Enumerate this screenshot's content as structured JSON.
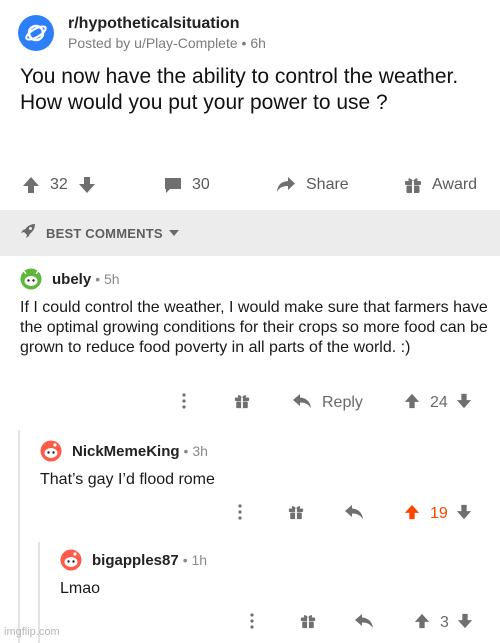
{
  "post": {
    "subreddit": "r/hypotheticalsituation",
    "posted_by": "Posted by u/Play-Complete • 6h",
    "title": "You now have the ability to control the weather. How would you put your power to use ?",
    "score": "32",
    "comment_count": "30",
    "share_label": "Share",
    "award_label": "Award"
  },
  "sort": {
    "label": "BEST COMMENTS"
  },
  "comments": [
    {
      "user": "ubely",
      "age": "• 5h",
      "body": "If I could control the weather, I would make sure that farmers have the optimal growing conditions for their crops so more food can be grown to reduce food poverty in all parts of the world. :)",
      "reply_label": "Reply",
      "score": "24"
    },
    {
      "user": "NickMemeKing",
      "age": "• 3h",
      "body": "That’s gay I’d flood rome",
      "score": "19"
    },
    {
      "user": "bigapples87",
      "age": "• 1h",
      "body": "Lmao",
      "score": "3"
    }
  ],
  "watermark": "imgflip.com",
  "colors": {
    "upvoted": "#ff4500",
    "icon_gray": "#6f6f6f",
    "sub_icon_blue": "#2d7ff9"
  }
}
